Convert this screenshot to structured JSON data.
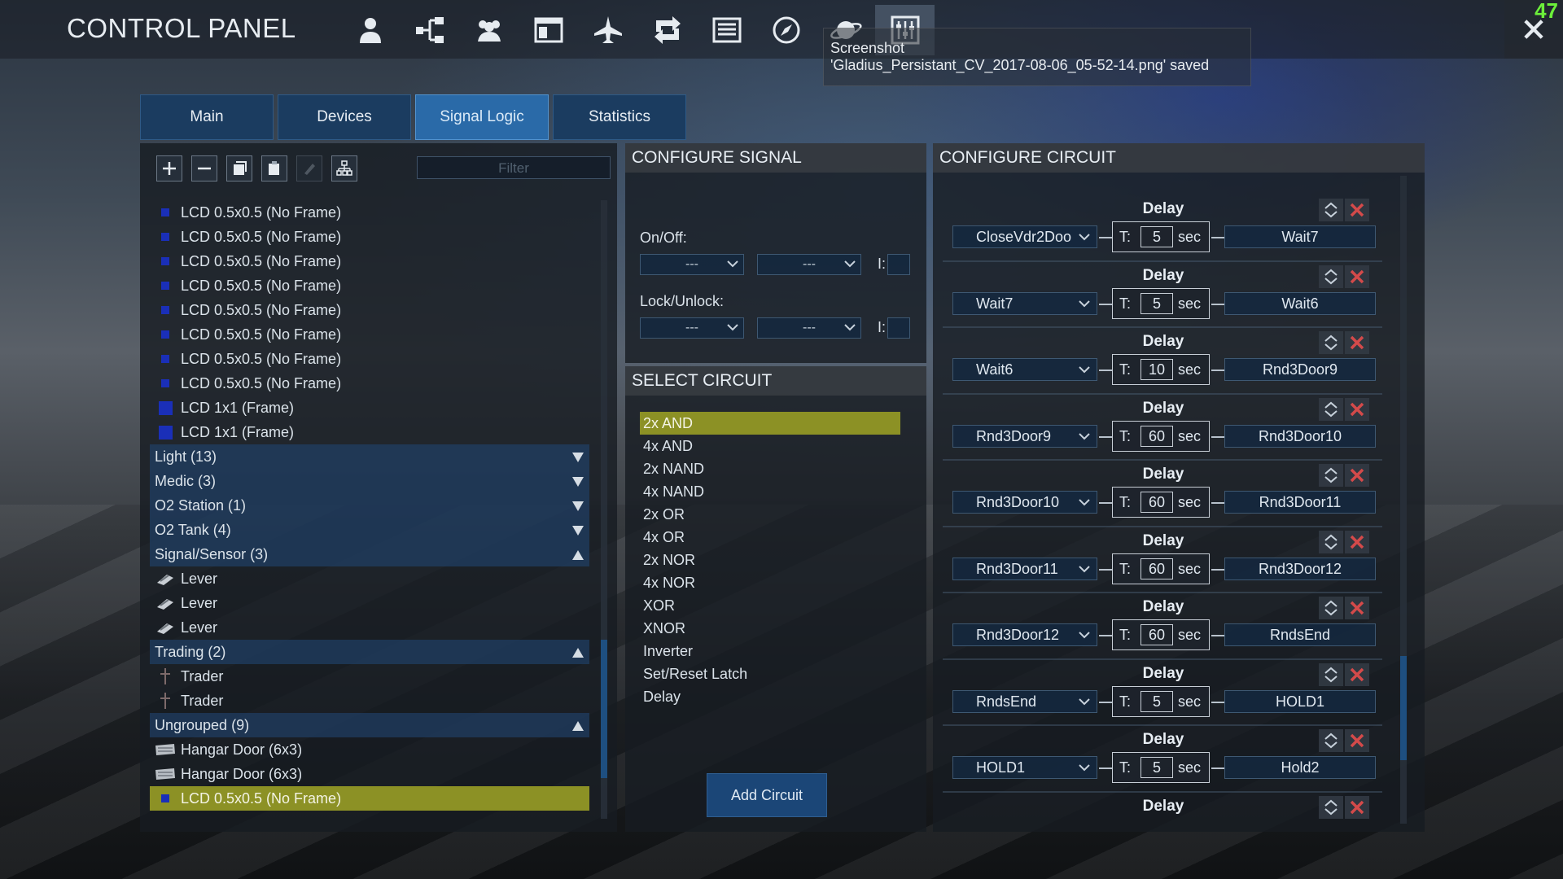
{
  "app": {
    "title": "CONTROL PANEL",
    "fps": "47"
  },
  "toast": {
    "line1": "Screenshot",
    "line2": "'Gladius_Persistant_CV_2017-08-06_05-52-14.png' saved"
  },
  "topbar_icons": [
    "person-icon",
    "network-icon",
    "group-icon",
    "window-icon",
    "ship-icon",
    "transfer-icon",
    "list-icon",
    "compass-icon",
    "planet-icon",
    "signal-logic-icon"
  ],
  "tabs": [
    "Main",
    "Devices",
    "Signal Logic",
    "Statistics"
  ],
  "active_tab": "Signal Logic",
  "filter": {
    "placeholder": "Filter"
  },
  "device_list": [
    {
      "label": "LCD 0.5x0.5 (No Frame)",
      "type": "item",
      "icon": "lcd-small-icon"
    },
    {
      "label": "LCD 0.5x0.5 (No Frame)",
      "type": "item",
      "icon": "lcd-small-icon"
    },
    {
      "label": "LCD 0.5x0.5 (No Frame)",
      "type": "item",
      "icon": "lcd-small-icon"
    },
    {
      "label": "LCD 0.5x0.5 (No Frame)",
      "type": "item",
      "icon": "lcd-small-icon"
    },
    {
      "label": "LCD 0.5x0.5 (No Frame)",
      "type": "item",
      "icon": "lcd-small-icon"
    },
    {
      "label": "LCD 0.5x0.5 (No Frame)",
      "type": "item",
      "icon": "lcd-small-icon"
    },
    {
      "label": "LCD 0.5x0.5 (No Frame)",
      "type": "item",
      "icon": "lcd-small-icon"
    },
    {
      "label": "LCD 0.5x0.5 (No Frame)",
      "type": "item",
      "icon": "lcd-small-icon"
    },
    {
      "label": "LCD 1x1 (Frame)",
      "type": "item",
      "icon": "lcd-large-icon"
    },
    {
      "label": "LCD 1x1 (Frame)",
      "type": "item",
      "icon": "lcd-large-icon"
    },
    {
      "label": "Light (13)",
      "type": "group",
      "expanded": false
    },
    {
      "label": "Medic (3)",
      "type": "group",
      "expanded": false
    },
    {
      "label": "O2 Station (1)",
      "type": "group",
      "expanded": false
    },
    {
      "label": "O2 Tank (4)",
      "type": "group",
      "expanded": false
    },
    {
      "label": "Signal/Sensor (3)",
      "type": "group",
      "expanded": true
    },
    {
      "label": "Lever",
      "type": "item",
      "icon": "lever-icon"
    },
    {
      "label": "Lever",
      "type": "item",
      "icon": "lever-icon"
    },
    {
      "label": "Lever",
      "type": "item",
      "icon": "lever-icon"
    },
    {
      "label": "Trading (2)",
      "type": "group",
      "expanded": true
    },
    {
      "label": "Trader",
      "type": "item",
      "icon": "trader-icon"
    },
    {
      "label": "Trader",
      "type": "item",
      "icon": "trader-icon"
    },
    {
      "label": "Ungrouped (9)",
      "type": "group",
      "expanded": true
    },
    {
      "label": "Hangar Door (6x3)",
      "type": "item",
      "icon": "hangar-door-icon"
    },
    {
      "label": "Hangar Door (6x3)",
      "type": "item",
      "icon": "hangar-door-icon"
    },
    {
      "label": "LCD 0.5x0.5 (No Frame)",
      "type": "item",
      "icon": "lcd-small-icon",
      "selected": true
    }
  ],
  "configure_signal": {
    "header": "CONFIGURE SIGNAL",
    "onoff_label": "On/Off:",
    "lock_label": "Lock/Unlock:",
    "dropdown_value": "---",
    "inverse_label": "I:"
  },
  "select_circuit": {
    "header": "SELECT CIRCUIT",
    "items": [
      "2x AND",
      "4x AND",
      "2x NAND",
      "4x NAND",
      "2x OR",
      "4x OR",
      "2x NOR",
      "4x NOR",
      "XOR",
      "XNOR",
      "Inverter",
      "Set/Reset Latch",
      "Delay"
    ],
    "selected": "2x AND",
    "add_button": "Add Circuit"
  },
  "configure_circuit": {
    "header": "CONFIGURE CIRCUIT",
    "t_label": "T:",
    "unit": "sec",
    "blocks": [
      {
        "title": "Delay",
        "input": "CloseVdr2Doo",
        "time": "5",
        "output": "Wait7"
      },
      {
        "title": "Delay",
        "input": "Wait7",
        "time": "5",
        "output": "Wait6"
      },
      {
        "title": "Delay",
        "input": "Wait6",
        "time": "10",
        "output": "Rnd3Door9"
      },
      {
        "title": "Delay",
        "input": "Rnd3Door9",
        "time": "60",
        "output": "Rnd3Door10"
      },
      {
        "title": "Delay",
        "input": "Rnd3Door10",
        "time": "60",
        "output": "Rnd3Door11"
      },
      {
        "title": "Delay",
        "input": "Rnd3Door11",
        "time": "60",
        "output": "Rnd3Door12"
      },
      {
        "title": "Delay",
        "input": "Rnd3Door12",
        "time": "60",
        "output": "RndsEnd"
      },
      {
        "title": "Delay",
        "input": "RndsEnd",
        "time": "5",
        "output": "HOLD1"
      },
      {
        "title": "Delay",
        "input": "HOLD1",
        "time": "5",
        "output": "Hold2"
      },
      {
        "title": "Delay"
      }
    ]
  },
  "colors": {
    "accent": "#2a6aa8",
    "selected": "#8c9125",
    "panel": "#161c22",
    "fps": "#6cf03a"
  }
}
